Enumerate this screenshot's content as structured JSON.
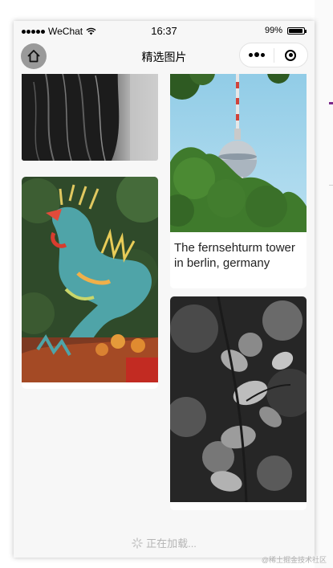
{
  "status_bar": {
    "carrier": "WeChat",
    "time": "16:37",
    "battery": "99%"
  },
  "navbar": {
    "title": "精选图片",
    "home_icon": "home-icon",
    "more_icon": "more-dots-icon",
    "close_icon": "target-icon"
  },
  "feed": {
    "cards": [
      {
        "image": "woman-hair-bw",
        "caption": ""
      },
      {
        "image": "dragon-statue",
        "caption": ""
      },
      {
        "image": "tv-tower",
        "caption": "The fernsehturm tower in berlin, germany"
      },
      {
        "image": "leaves-bw",
        "caption": ""
      }
    ]
  },
  "footer": {
    "loading_text": "正在加载..."
  },
  "watermark": "@稀土掘金技术社区",
  "colors": {
    "page_bg": "#f7f7f7",
    "card_bg": "#ffffff",
    "accent_purple": "#7b2a8b"
  }
}
